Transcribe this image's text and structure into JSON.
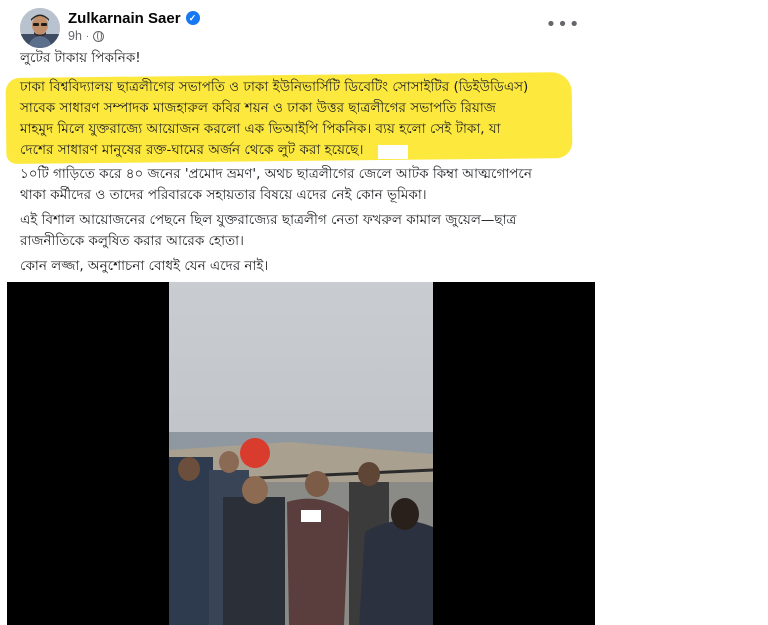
{
  "author": {
    "name": "Zulkarnain Saer",
    "time": "9h"
  },
  "post": {
    "title_line": "লুটের টাকায় পিকনিক!",
    "highlight_lines": [
      "ঢাকা বিশ্ববিদ্যালয় ছাত্রলীগের সভাপতি ও ঢাকা ইউনিভার্সিটি ডিবেটিং সোসাইটির (ডিইউডিএস)",
      "সাবেক সাধারণ সম্পাদক মাজহারুল কবির শয়ন ও ঢাকা উত্তর ছাত্রলীগের সভাপতি রিয়াজ",
      "মাহমুদ মিলে যুক্তরাজ্যে আয়োজন করলো এক  ভিআইপি পিকনিক। ব্যয় হলো সেই টাকা, যা",
      "দেশের সাধারণ মানুষের রক্ত-ঘামের অর্জন থেকে লুট করা হয়েছে।"
    ],
    "para2_lines": [
      "১০টি গাড়িতে করে ৪০ জনের 'প্রমোদ ভ্রমণ', অথচ ছাত্রলীগের জেলে আটক কিম্বা আত্মগোপনে",
      "থাকা কর্মীদের ও তাদের পরিবারকে সহায়তার বিষয়ে এদের নেই কোন ভূমিকা।"
    ],
    "para3_lines": [
      "এই বিশাল আয়োজনের পেছনে ছিল যুক্তরাজ্যের ছাত্রলীগ নেতা ফখরুল কামাল জুয়েল—ছাত্র",
      "রাজনীতিকে কলুষিত করার আরেক হোতা।"
    ],
    "para4_lines": [
      "কোন লজ্জা, অনুশোচনা বোধই যেন এদের নাই।"
    ]
  },
  "icons": {
    "verified": "verified-badge-icon",
    "audience": "globe-icon",
    "more": "more-options-icon"
  },
  "colors": {
    "highlight": "#fde93e",
    "verified": "#1877f2",
    "meta_text": "#65676b"
  }
}
